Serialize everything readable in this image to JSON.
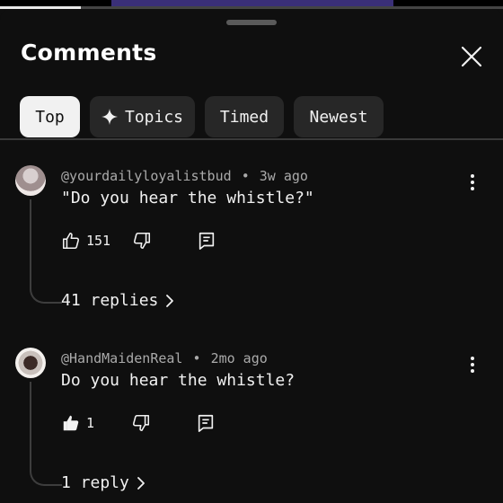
{
  "panel": {
    "title": "Comments"
  },
  "filters": {
    "top": "Top",
    "topics": "Topics",
    "timed": "Timed",
    "newest": "Newest"
  },
  "comments": [
    {
      "author": "@yourdailyloyalistbud",
      "age": "3w ago",
      "text": "\"Do you hear the whistle?\"",
      "likes": "151",
      "replies": "41 replies",
      "liked": false
    },
    {
      "author": "@HandMaidenReal",
      "age": "2mo ago",
      "text": "Do you hear the whistle?",
      "likes": "1",
      "replies": "1 reply",
      "liked": true
    }
  ],
  "separator": "•",
  "icons": {
    "close": "close-icon",
    "topics": "sparkle-icon",
    "like": "thumbs-up-icon",
    "dislike": "thumbs-down-icon",
    "reply": "reply-icon",
    "more": "more-vertical-icon",
    "chevron": "chevron-right-icon"
  }
}
